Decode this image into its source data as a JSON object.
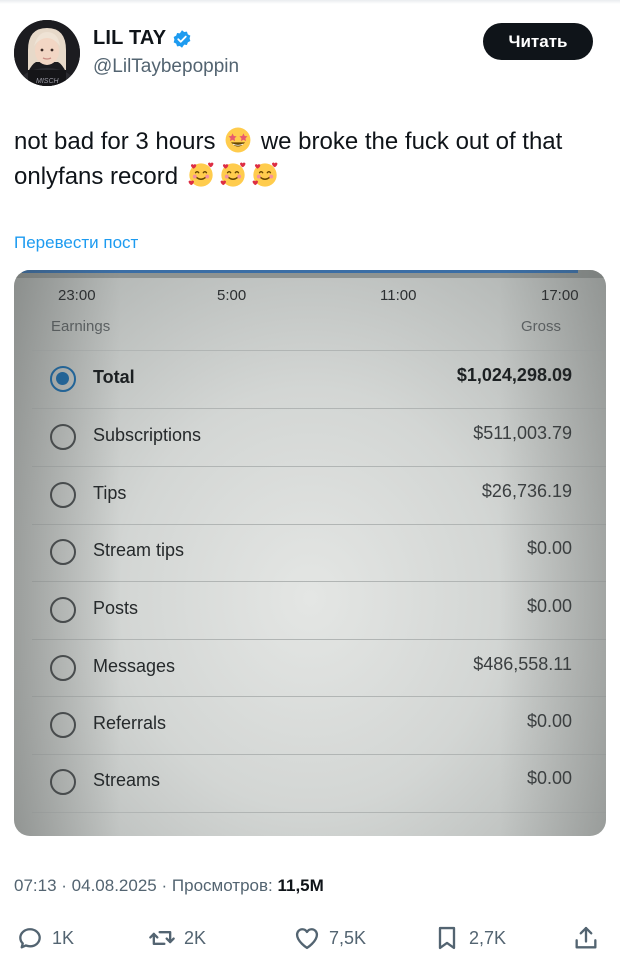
{
  "author": {
    "name": "LIL TAY",
    "handle": "@LilTaybepoppin",
    "avatar_caption": "avatar"
  },
  "follow_button": {
    "label": "Читать"
  },
  "tweet": {
    "text_part1": "not bad for 3 hours",
    "text_part2": "we broke the fuck out of that onlyfans record",
    "emojis": [
      "star-struck-emoji",
      "smiling-face-with-hearts-emoji",
      "smiling-face-with-hearts-emoji",
      "smiling-face-with-hearts-emoji"
    ]
  },
  "translate_link": "Перевести пост",
  "photo": {
    "times": [
      "23:00",
      "5:00",
      "11:00",
      "17:00"
    ],
    "columns": {
      "left": "Earnings",
      "right": "Gross"
    },
    "rows": [
      {
        "label": "Total",
        "value": "$1,024,298.09",
        "selected": true
      },
      {
        "label": "Subscriptions",
        "value": "$511,003.79",
        "selected": false
      },
      {
        "label": "Tips",
        "value": "$26,736.19",
        "selected": false
      },
      {
        "label": "Stream tips",
        "value": "$0.00",
        "selected": false
      },
      {
        "label": "Posts",
        "value": "$0.00",
        "selected": false
      },
      {
        "label": "Messages",
        "value": "$486,558.11",
        "selected": false
      },
      {
        "label": "Referrals",
        "value": "$0.00",
        "selected": false
      },
      {
        "label": "Streams",
        "value": "$0.00",
        "selected": false
      }
    ]
  },
  "meta": {
    "time": "07:13",
    "date": "04.08.2025",
    "views_label": "Просмотров:",
    "views_count": "11,5M"
  },
  "actions": {
    "replies": "1K",
    "reposts": "2K",
    "likes": "7,5K",
    "bookmarks": "2,7K"
  },
  "colors": {
    "accent": "#1d9bf0",
    "text": "#0f1419",
    "muted": "#536471",
    "follow_bg": "#0f1419",
    "radio_selected": "#1f6aa5"
  }
}
